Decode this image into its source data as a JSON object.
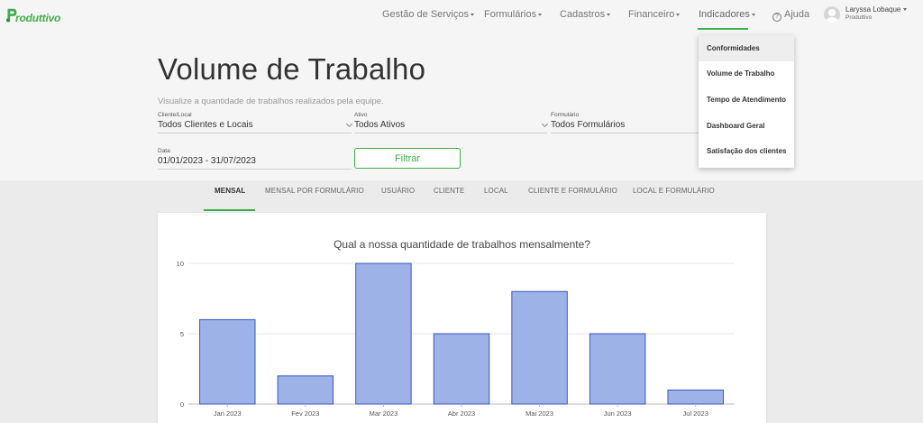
{
  "app": {
    "logo_text": "roduttivo"
  },
  "nav": {
    "items": [
      {
        "label": "Gestão de Serviços"
      },
      {
        "label": "Formulários"
      },
      {
        "label": "Cadastros"
      },
      {
        "label": "Financeiro"
      },
      {
        "label": "Indicadores"
      }
    ],
    "help_label": "Ajuda",
    "help_glyph": "?",
    "user_name": "Laryssa Lobaque",
    "user_org": "Produttivo"
  },
  "dropdown": {
    "items": [
      {
        "label": "Conformidades"
      },
      {
        "label": "Volume de Trabalho"
      },
      {
        "label": "Tempo de Atendimento"
      },
      {
        "label": "Dashboard Geral"
      },
      {
        "label": "Satisfação dos clientes"
      }
    ]
  },
  "page": {
    "title": "Volume de Trabalho",
    "subtitle": "Visualize a quantidade de trabalhos realizados pela equipe."
  },
  "filters": {
    "client": {
      "label": "Cliente/Local",
      "value": "Todos Clientes e Locais"
    },
    "active": {
      "label": "Ativo",
      "value": "Todos Ativos"
    },
    "form": {
      "label": "Formulário",
      "value": "Todos Formulários"
    },
    "date": {
      "label": "Data",
      "value": "01/01/2023 - 31/07/2023"
    },
    "button_label": "Filtrar"
  },
  "tabs": [
    {
      "label": "MENSAL"
    },
    {
      "label": "MENSAL POR FORMULÁRIO"
    },
    {
      "label": "USUÁRIO"
    },
    {
      "label": "CLIENTE"
    },
    {
      "label": "LOCAL"
    },
    {
      "label": "CLIENTE E FORMULÁRIO"
    },
    {
      "label": "LOCAL E FORMULÁRIO"
    }
  ],
  "colors": {
    "brand": "#3fae49",
    "bar_fill": "#9db2e6",
    "bar_stroke": "#3b55c4"
  },
  "chart_data": {
    "type": "bar",
    "title": "Qual a nossa quantidade de trabalhos mensalmente?",
    "categories": [
      "Jan 2023",
      "Fev 2023",
      "Mar 2023",
      "Abr 2023",
      "Mai 2023",
      "Jun 2023",
      "Jul 2023"
    ],
    "values": [
      6,
      2,
      10,
      5,
      8,
      5,
      1
    ],
    "ylim": [
      0,
      10
    ],
    "yticks": [
      "0",
      "5",
      "10"
    ],
    "grid": true
  }
}
